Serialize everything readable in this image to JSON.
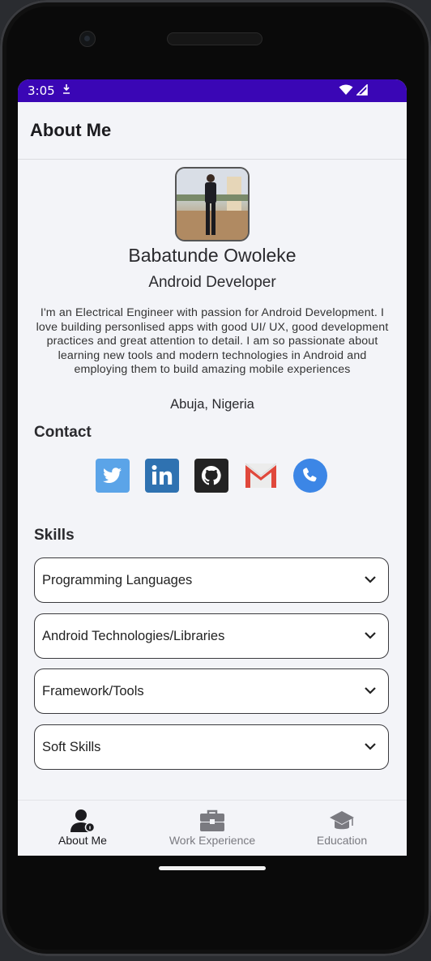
{
  "status_bar": {
    "time": "3:05"
  },
  "app_bar": {
    "title": "About Me"
  },
  "profile": {
    "name": "Babatunde Owoleke",
    "role": "Android Developer",
    "bio": "I'm an Electrical Engineer with passion for Android Development. I love building personlised apps with good UI/ UX, good development practices and great attention to detail. I am so passionate about learning new tools and modern technologies in Android and employing them to build amazing mobile experiences",
    "location": "Abuja, Nigeria"
  },
  "contact": {
    "title": "Contact",
    "items": [
      {
        "icon": "twitter-icon",
        "color": "#5ba4e8"
      },
      {
        "icon": "linkedin-icon",
        "color": "#2f72b1"
      },
      {
        "icon": "github-icon",
        "color": "#232323"
      },
      {
        "icon": "gmail-icon",
        "color": "#e0483c"
      },
      {
        "icon": "phone-icon",
        "color": "#3c86e6"
      }
    ]
  },
  "skills": {
    "title": "Skills",
    "items": [
      {
        "label": "Programming Languages"
      },
      {
        "label": "Android Technologies/Libraries"
      },
      {
        "label": "Framework/Tools"
      },
      {
        "label": "Soft Skills"
      }
    ]
  },
  "bottom_nav": {
    "items": [
      {
        "label": "About Me",
        "icon": "person-icon",
        "active": true
      },
      {
        "label": "Work Experience",
        "icon": "briefcase-icon",
        "active": false
      },
      {
        "label": "Education",
        "icon": "graduation-cap-icon",
        "active": false
      }
    ]
  },
  "colors": {
    "status_bar": "#3a06b5",
    "background": "#f3f4f8",
    "active_nav": "#1b1b1f",
    "inactive_nav": "#7a7a80"
  }
}
